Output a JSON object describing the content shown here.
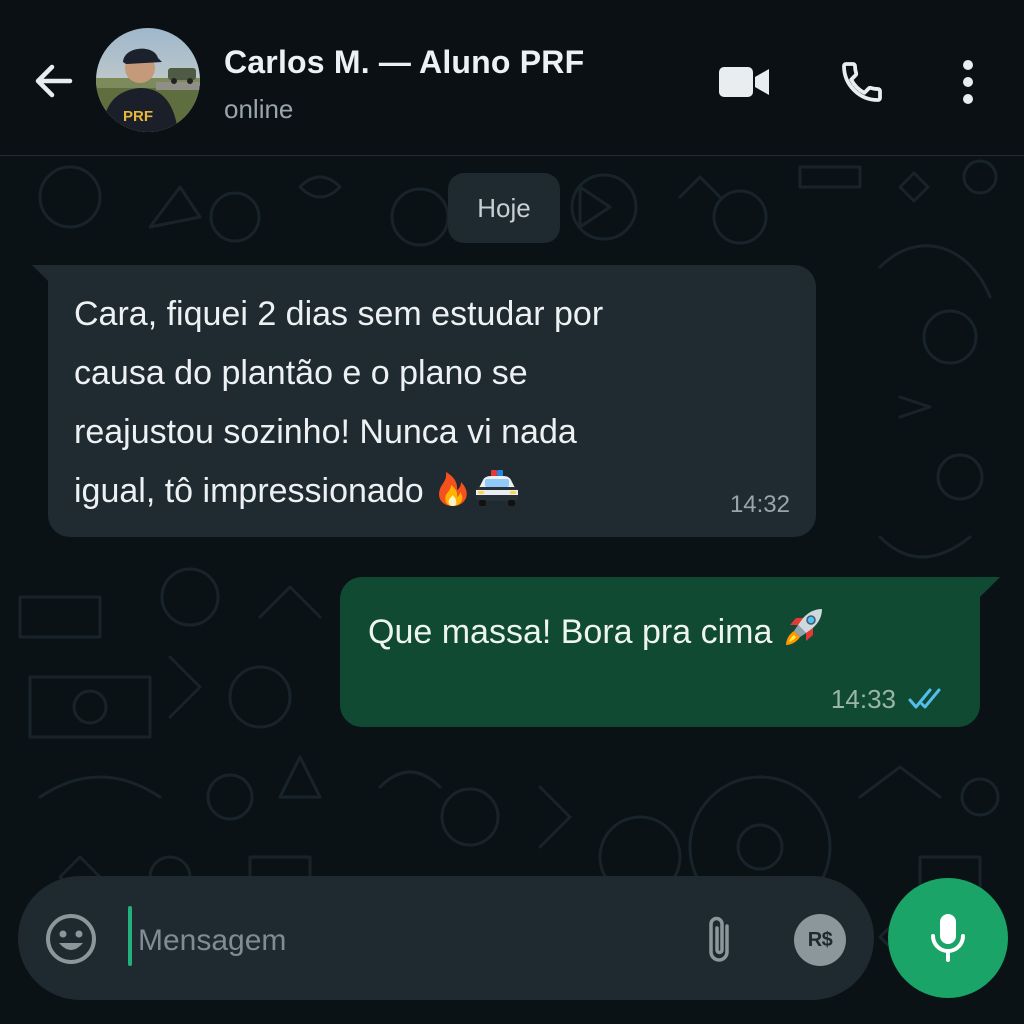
{
  "header": {
    "contact_name": "Carlos M. — Aluno PRF",
    "status": "online",
    "avatar_badge": "PRF",
    "icons": [
      "back-arrow-icon",
      "video-camera-icon",
      "phone-icon",
      "more-vertical-icon"
    ]
  },
  "chat": {
    "date_label": "Hoje",
    "messages": [
      {
        "direction": "incoming",
        "lines": [
          "Cara, fiquei 2 dias sem estudar por",
          "causa do plantão e o plano se",
          "reajustou sozinho! Nunca vi nada",
          "igual, tô impressionado"
        ],
        "emojis": [
          "fire-emoji",
          "police-car-emoji"
        ],
        "time": "14:32"
      },
      {
        "direction": "outgoing",
        "text": "Que massa! Bora pra cima",
        "emojis": [
          "rocket-emoji"
        ],
        "time": "14:33",
        "status": "read"
      }
    ]
  },
  "composer": {
    "placeholder": "Mensagem",
    "value": "",
    "payment_label": "R$",
    "icons": [
      "emoji-icon",
      "paperclip-icon",
      "payment-icon",
      "microphone-icon"
    ]
  },
  "colors": {
    "header_bg": "#0b1014",
    "chat_bg": "#0b1215",
    "incoming_bubble": "#1f2b31",
    "outgoing_bubble": "#104a33",
    "accent_green": "#1aa468",
    "read_tick_blue": "#53bdeb"
  }
}
